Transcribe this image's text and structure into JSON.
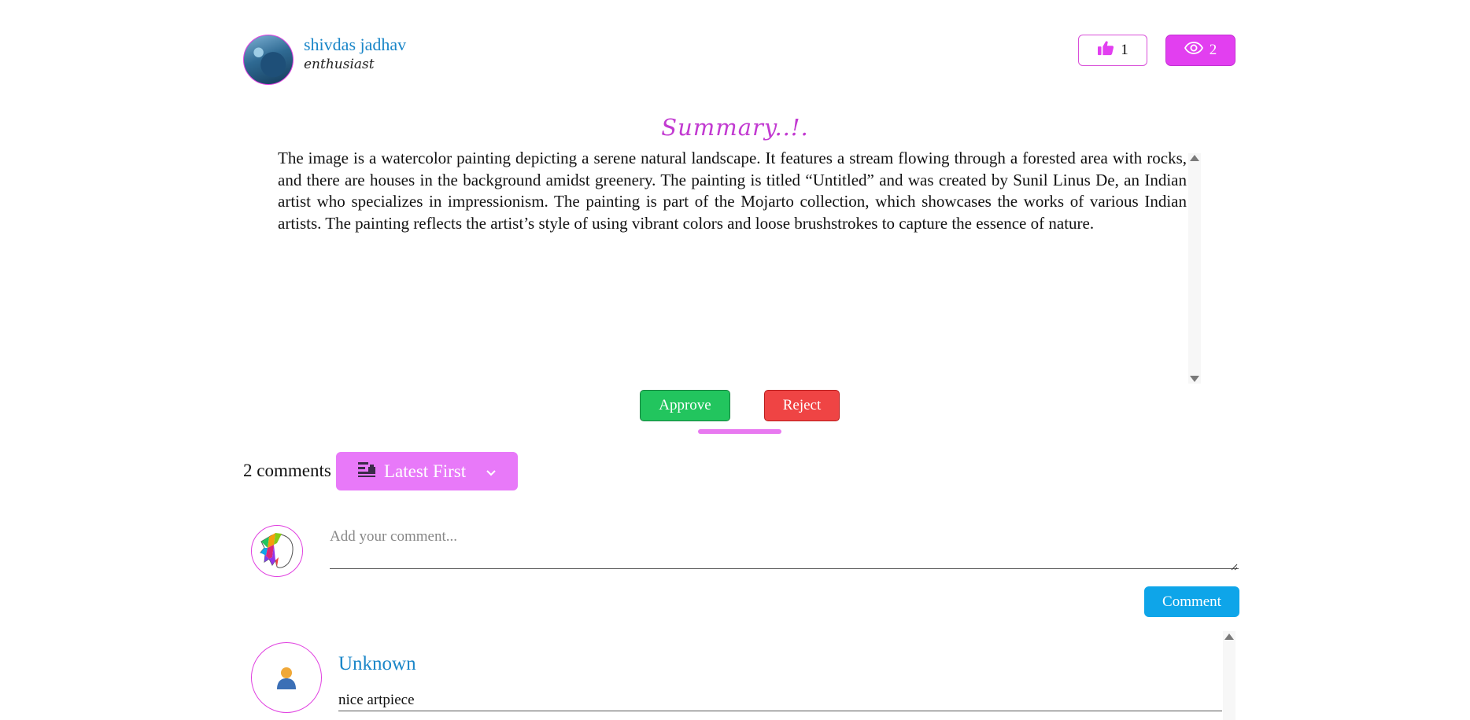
{
  "author": {
    "name": "shivdas jadhav",
    "role": "enthusiast"
  },
  "stats": {
    "likes": "1",
    "views": "2"
  },
  "summary": {
    "title": "Summary..!.",
    "text": "The image is a watercolor painting depicting a serene natural landscape. It features a stream flowing through a forested area with rocks, and there are houses in the background amidst greenery. The painting is titled “Untitled” and was created by Sunil Linus De, an Indian artist who specializes in impressionism. The painting is part of the Mojarto collection, which showcases the works of various Indian artists. The painting reflects the artist’s style of using vibrant colors and loose brushstrokes to capture the essence of nature."
  },
  "actions": {
    "approve": "Approve",
    "reject": "Reject"
  },
  "comments": {
    "count_label": "2 comments",
    "sort_label": "Latest First",
    "input_placeholder": "Add your comment...",
    "submit_label": "Comment",
    "items": [
      {
        "author": "Unknown",
        "text": "nice artpiece"
      }
    ]
  },
  "colors": {
    "accent": "#e23ff0",
    "sort_bg": "#e879f9",
    "approve": "#22c55e",
    "reject": "#ef4444",
    "comment_btn": "#0ea5e9",
    "link": "#1a86c8"
  },
  "icons": {
    "like": "thumbs-up-icon",
    "views": "eye-icon",
    "sort": "sort-list-icon",
    "dropdown": "chevron-down-icon",
    "unknown_user": "user-icon"
  }
}
